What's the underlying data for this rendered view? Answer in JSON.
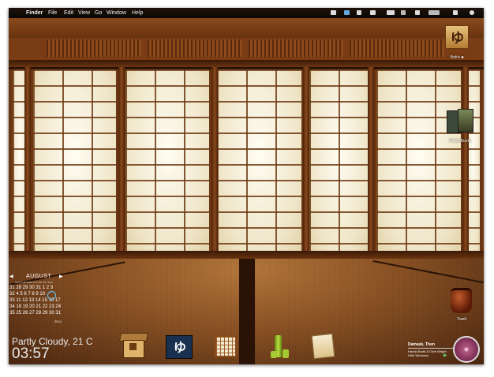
{
  "menubar": {
    "apple": "",
    "items": [
      "Finder",
      "File",
      "Edit",
      "View",
      "Go",
      "Window",
      "Help"
    ]
  },
  "desktop_icons": [
    {
      "name": "hd-icon",
      "label": "Bob's ■"
    },
    {
      "name": "photo-booth-icon",
      "label": "Photo Booth"
    },
    {
      "name": "trash-icon",
      "label": "Trash"
    }
  ],
  "calendar": {
    "month": "AUGUST",
    "dow": "MON TUE WED THU FRI SAT SUN",
    "rows": [
      "31 28 29 30 31  1  2  3",
      "32  4  5  6  7  8  9 10",
      "33 11 12 13 14 15 16 17",
      "34 18 19 20 21 22 23 24",
      "35 25 26 27 28 29 30 31"
    ],
    "year": "2014"
  },
  "weather": "Partly Cloudy, 21 C",
  "clock": "03:57",
  "music": {
    "title": "Damask, Then",
    "artist": "Harold Budd & Clive Wright",
    "album": "Little Windows"
  },
  "colors": {
    "wood": "#6b3612",
    "paper": "#f4eedc",
    "menubar": "#0b0704"
  }
}
